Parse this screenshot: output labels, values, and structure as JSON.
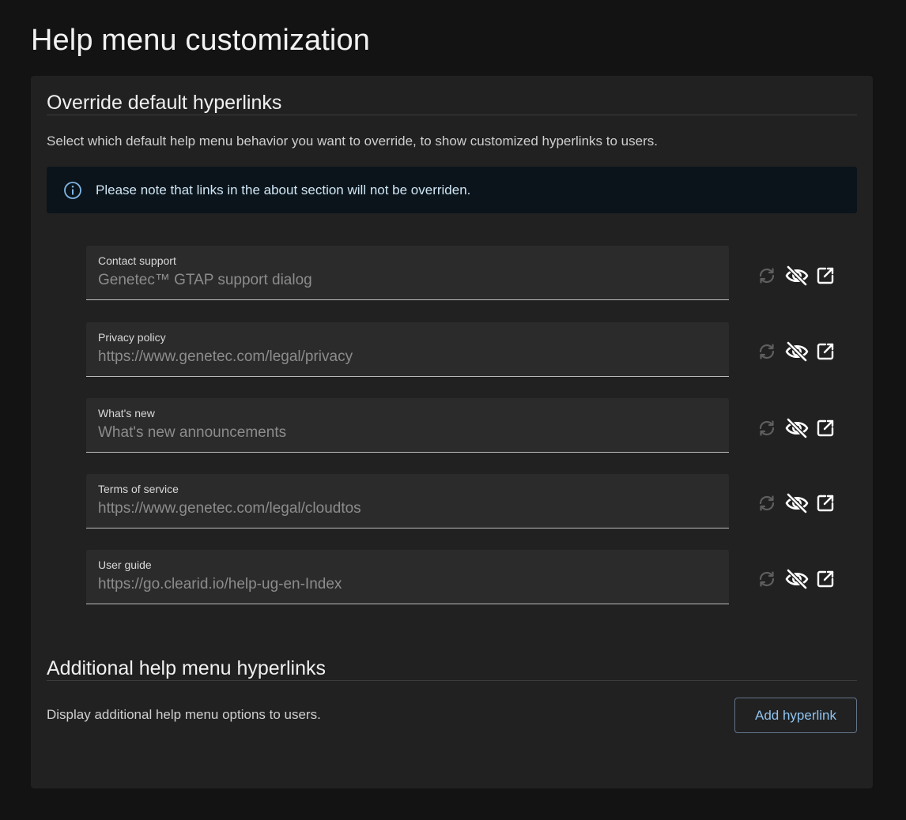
{
  "page": {
    "title": "Help menu customization"
  },
  "override": {
    "title": "Override default hyperlinks",
    "description": "Select which default help menu behavior you want to override, to show customized hyperlinks to users.",
    "info": {
      "icon": "info-icon",
      "text": "Please note that links in the about section will not be overriden."
    },
    "fields": [
      {
        "label": "Contact support",
        "value": "Genetec™ GTAP support dialog"
      },
      {
        "label": "Privacy policy",
        "value": "https://www.genetec.com/legal/privacy"
      },
      {
        "label": "What's new",
        "value": "What's new announcements"
      },
      {
        "label": "Terms of service",
        "value": "https://www.genetec.com/legal/cloudtos"
      },
      {
        "label": "User guide",
        "value": "https://go.clearid.io/help-ug-en-Index"
      }
    ],
    "field_actions": [
      {
        "icon": "reset-icon",
        "enabled": false
      },
      {
        "icon": "eye-off-icon",
        "enabled": true
      },
      {
        "icon": "open-external-icon",
        "enabled": true
      }
    ]
  },
  "additional": {
    "title": "Additional help menu hyperlinks",
    "description": "Display additional help menu options to users.",
    "add_button": "Add hyperlink"
  },
  "colors": {
    "background": "#131313",
    "card": "#212121",
    "field": "#2b2b2b",
    "info_banner": "#0b141a",
    "accent": "#8fc3ee",
    "disabled_icon": "#5e5e5e"
  }
}
